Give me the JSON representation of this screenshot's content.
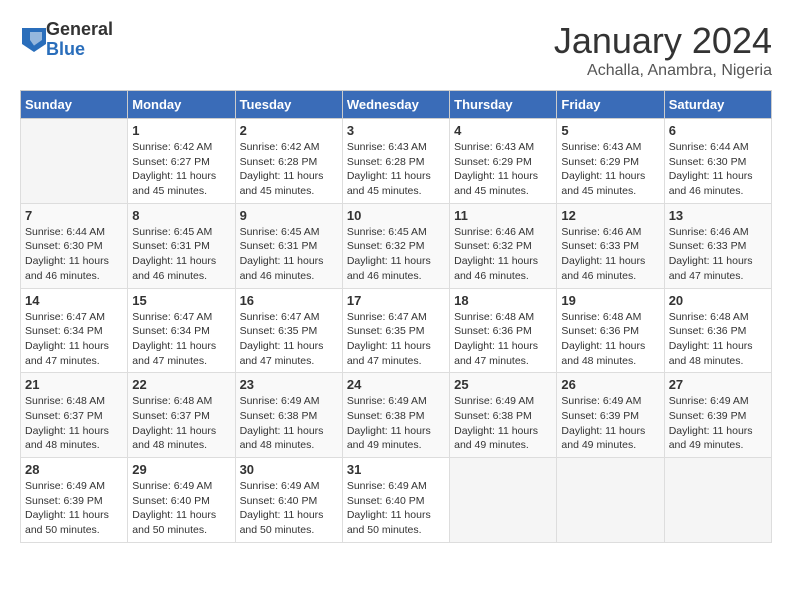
{
  "logo": {
    "general": "General",
    "blue": "Blue"
  },
  "title": "January 2024",
  "subtitle": "Achalla, Anambra, Nigeria",
  "days_header": [
    "Sunday",
    "Monday",
    "Tuesday",
    "Wednesday",
    "Thursday",
    "Friday",
    "Saturday"
  ],
  "weeks": [
    [
      {
        "day": "",
        "info": ""
      },
      {
        "day": "1",
        "info": "Sunrise: 6:42 AM\nSunset: 6:27 PM\nDaylight: 11 hours\nand 45 minutes."
      },
      {
        "day": "2",
        "info": "Sunrise: 6:42 AM\nSunset: 6:28 PM\nDaylight: 11 hours\nand 45 minutes."
      },
      {
        "day": "3",
        "info": "Sunrise: 6:43 AM\nSunset: 6:28 PM\nDaylight: 11 hours\nand 45 minutes."
      },
      {
        "day": "4",
        "info": "Sunrise: 6:43 AM\nSunset: 6:29 PM\nDaylight: 11 hours\nand 45 minutes."
      },
      {
        "day": "5",
        "info": "Sunrise: 6:43 AM\nSunset: 6:29 PM\nDaylight: 11 hours\nand 45 minutes."
      },
      {
        "day": "6",
        "info": "Sunrise: 6:44 AM\nSunset: 6:30 PM\nDaylight: 11 hours\nand 46 minutes."
      }
    ],
    [
      {
        "day": "7",
        "info": "Sunrise: 6:44 AM\nSunset: 6:30 PM\nDaylight: 11 hours\nand 46 minutes."
      },
      {
        "day": "8",
        "info": "Sunrise: 6:45 AM\nSunset: 6:31 PM\nDaylight: 11 hours\nand 46 minutes."
      },
      {
        "day": "9",
        "info": "Sunrise: 6:45 AM\nSunset: 6:31 PM\nDaylight: 11 hours\nand 46 minutes."
      },
      {
        "day": "10",
        "info": "Sunrise: 6:45 AM\nSunset: 6:32 PM\nDaylight: 11 hours\nand 46 minutes."
      },
      {
        "day": "11",
        "info": "Sunrise: 6:46 AM\nSunset: 6:32 PM\nDaylight: 11 hours\nand 46 minutes."
      },
      {
        "day": "12",
        "info": "Sunrise: 6:46 AM\nSunset: 6:33 PM\nDaylight: 11 hours\nand 46 minutes."
      },
      {
        "day": "13",
        "info": "Sunrise: 6:46 AM\nSunset: 6:33 PM\nDaylight: 11 hours\nand 47 minutes."
      }
    ],
    [
      {
        "day": "14",
        "info": "Sunrise: 6:47 AM\nSunset: 6:34 PM\nDaylight: 11 hours\nand 47 minutes."
      },
      {
        "day": "15",
        "info": "Sunrise: 6:47 AM\nSunset: 6:34 PM\nDaylight: 11 hours\nand 47 minutes."
      },
      {
        "day": "16",
        "info": "Sunrise: 6:47 AM\nSunset: 6:35 PM\nDaylight: 11 hours\nand 47 minutes."
      },
      {
        "day": "17",
        "info": "Sunrise: 6:47 AM\nSunset: 6:35 PM\nDaylight: 11 hours\nand 47 minutes."
      },
      {
        "day": "18",
        "info": "Sunrise: 6:48 AM\nSunset: 6:36 PM\nDaylight: 11 hours\nand 47 minutes."
      },
      {
        "day": "19",
        "info": "Sunrise: 6:48 AM\nSunset: 6:36 PM\nDaylight: 11 hours\nand 48 minutes."
      },
      {
        "day": "20",
        "info": "Sunrise: 6:48 AM\nSunset: 6:36 PM\nDaylight: 11 hours\nand 48 minutes."
      }
    ],
    [
      {
        "day": "21",
        "info": "Sunrise: 6:48 AM\nSunset: 6:37 PM\nDaylight: 11 hours\nand 48 minutes."
      },
      {
        "day": "22",
        "info": "Sunrise: 6:48 AM\nSunset: 6:37 PM\nDaylight: 11 hours\nand 48 minutes."
      },
      {
        "day": "23",
        "info": "Sunrise: 6:49 AM\nSunset: 6:38 PM\nDaylight: 11 hours\nand 48 minutes."
      },
      {
        "day": "24",
        "info": "Sunrise: 6:49 AM\nSunset: 6:38 PM\nDaylight: 11 hours\nand 49 minutes."
      },
      {
        "day": "25",
        "info": "Sunrise: 6:49 AM\nSunset: 6:38 PM\nDaylight: 11 hours\nand 49 minutes."
      },
      {
        "day": "26",
        "info": "Sunrise: 6:49 AM\nSunset: 6:39 PM\nDaylight: 11 hours\nand 49 minutes."
      },
      {
        "day": "27",
        "info": "Sunrise: 6:49 AM\nSunset: 6:39 PM\nDaylight: 11 hours\nand 49 minutes."
      }
    ],
    [
      {
        "day": "28",
        "info": "Sunrise: 6:49 AM\nSunset: 6:39 PM\nDaylight: 11 hours\nand 50 minutes."
      },
      {
        "day": "29",
        "info": "Sunrise: 6:49 AM\nSunset: 6:40 PM\nDaylight: 11 hours\nand 50 minutes."
      },
      {
        "day": "30",
        "info": "Sunrise: 6:49 AM\nSunset: 6:40 PM\nDaylight: 11 hours\nand 50 minutes."
      },
      {
        "day": "31",
        "info": "Sunrise: 6:49 AM\nSunset: 6:40 PM\nDaylight: 11 hours\nand 50 minutes."
      },
      {
        "day": "",
        "info": ""
      },
      {
        "day": "",
        "info": ""
      },
      {
        "day": "",
        "info": ""
      }
    ]
  ]
}
